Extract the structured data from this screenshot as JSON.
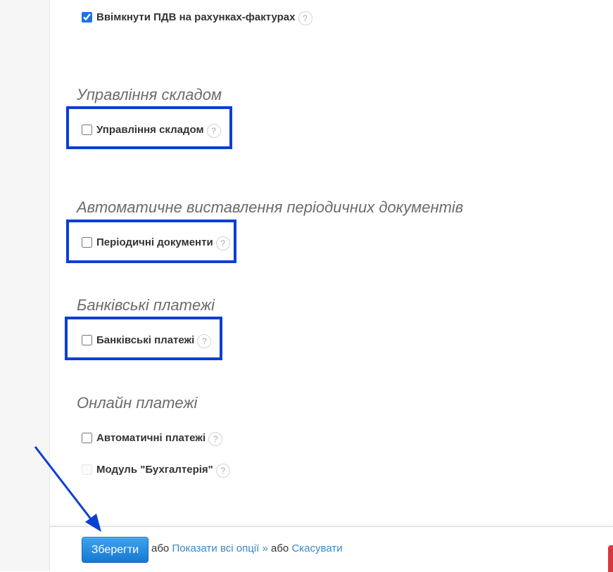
{
  "options": {
    "vat": {
      "label": "Ввімкнути ПДВ на рахунках-фактурах",
      "checked": true
    },
    "inventory": {
      "label": "Управління складом",
      "checked": false
    },
    "periodic": {
      "label": "Періодичні документи",
      "checked": false
    },
    "bank": {
      "label": "Банківські платежі",
      "checked": false
    },
    "auto_payments": {
      "label": "Автоматичні платежі",
      "checked": false
    },
    "accounting": {
      "label": "Модуль \"Бухгалтерія\"",
      "checked": false,
      "disabled": true
    }
  },
  "sections": {
    "inventory": "Управління складом",
    "periodic": "Автоматичне виставлення періодичних документів",
    "bank": "Банківські платежі",
    "online": "Онлайн платежі"
  },
  "help_glyph": "?",
  "footer": {
    "save_label": "Зберегти",
    "or1": "або",
    "show_all_label": "Показати всі опції »",
    "or2": "або",
    "cancel_label": "Скасувати"
  },
  "colors": {
    "highlight": "#0b3fd1",
    "link": "#3a87c8",
    "save_button": "#1f86db"
  }
}
